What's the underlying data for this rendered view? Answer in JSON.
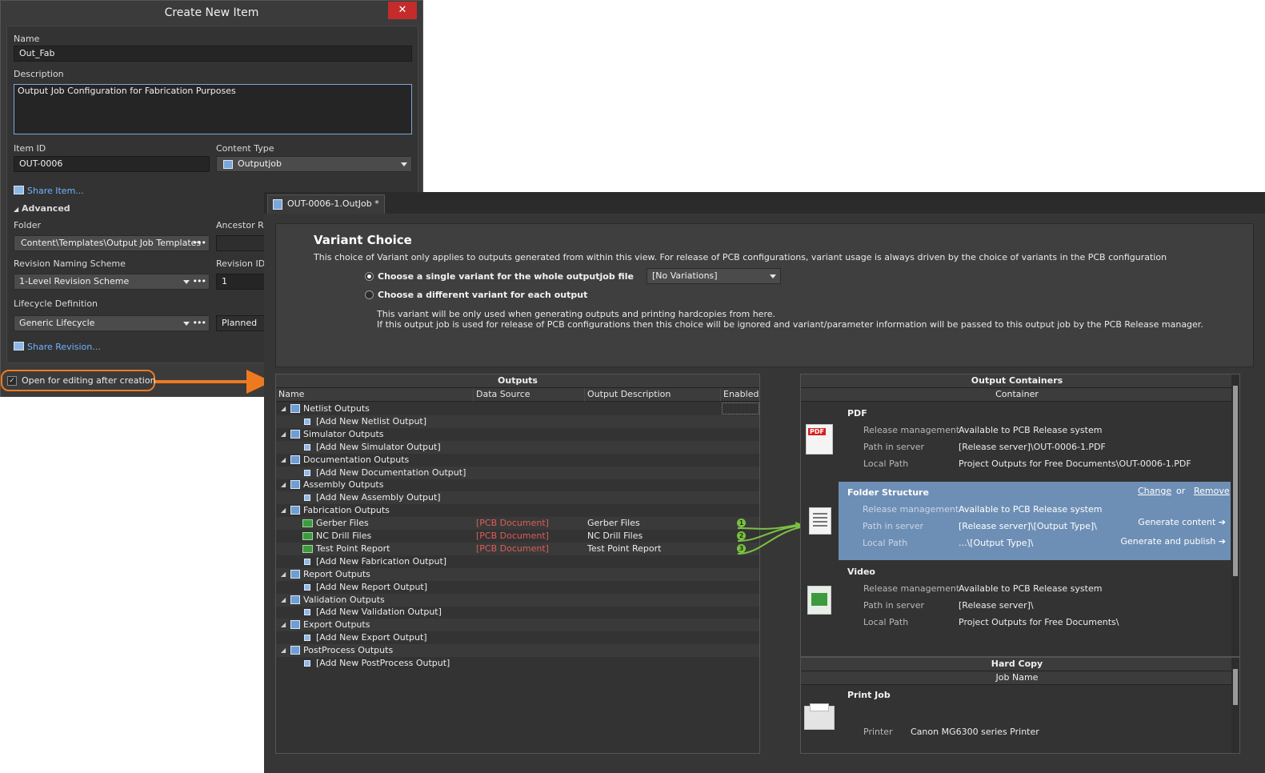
{
  "dialog": {
    "title": "Create New Item",
    "close": "✕",
    "name_label": "Name",
    "name_value": "Out_Fab",
    "description_label": "Description",
    "description_value": "Output Job Configuration for Fabrication Purposes",
    "item_id_label": "Item ID",
    "item_id_value": "OUT-0006",
    "content_type_label": "Content Type",
    "content_type_value": "Outputjob",
    "share_item": "Share Item...",
    "advanced": "Advanced",
    "folder_label": "Folder",
    "folder_value": "Content\\Templates\\Output Job Templates",
    "ancestor_label": "Ancestor Re",
    "revision_scheme_label": "Revision Naming Scheme",
    "revision_scheme_value": "1-Level Revision Scheme",
    "revision_id_label": "Revision ID",
    "revision_id_value": "1",
    "lifecycle_label": "Lifecycle Definition",
    "lifecycle_value": "Generic Lifecycle",
    "lifecycle_state": "Planned",
    "share_revision": "Share Revision...",
    "open_for_editing": "Open for editing after creation",
    "dots": "•••"
  },
  "editor": {
    "tab": "OUT-0006-1.OutJob *",
    "variant": {
      "title": "Variant Choice",
      "description": "This choice of Variant only applies to outputs generated from within this view. For release of PCB configurations, variant usage is always driven by the choice of variants in the PCB configuration",
      "option1": "Choose a single variant for the whole outputjob file",
      "option2": "Choose a different variant for each output",
      "variant_select": "[No Variations]",
      "note1": "This variant will be only used when generating outputs and printing hardcopies from here.",
      "note2": "If this output job is used for release of PCB configurations then this choice will be ignored and variant/parameter information will be passed to this output job by the PCB Release manager."
    },
    "outputs": {
      "title": "Outputs",
      "columns": [
        "Name",
        "Data Source",
        "Output Description",
        "Enabled"
      ],
      "rows": [
        {
          "kind": "group",
          "name": "Netlist Outputs"
        },
        {
          "kind": "add",
          "name": "[Add New Netlist Output]"
        },
        {
          "kind": "group",
          "name": "Simulator Outputs"
        },
        {
          "kind": "add",
          "name": "[Add New Simulator Output]"
        },
        {
          "kind": "group",
          "name": "Documentation Outputs"
        },
        {
          "kind": "add",
          "name": "[Add New Documentation Output]"
        },
        {
          "kind": "group",
          "name": "Assembly Outputs"
        },
        {
          "kind": "add",
          "name": "[Add New Assembly Output]"
        },
        {
          "kind": "group",
          "name": "Fabrication Outputs"
        },
        {
          "kind": "item",
          "name": "Gerber Files",
          "source": "[PCB Document]",
          "desc": "Gerber Files",
          "badge": "1"
        },
        {
          "kind": "item",
          "name": "NC Drill Files",
          "source": "[PCB Document]",
          "desc": "NC Drill Files",
          "badge": "2"
        },
        {
          "kind": "item",
          "name": "Test Point Report",
          "source": "[PCB Document]",
          "desc": "Test Point Report",
          "badge": "3"
        },
        {
          "kind": "add",
          "name": "[Add New Fabrication Output]"
        },
        {
          "kind": "group",
          "name": "Report Outputs"
        },
        {
          "kind": "add",
          "name": "[Add New Report Output]"
        },
        {
          "kind": "group",
          "name": "Validation Outputs"
        },
        {
          "kind": "add",
          "name": "[Add New Validation Output]"
        },
        {
          "kind": "group",
          "name": "Export Outputs"
        },
        {
          "kind": "add",
          "name": "[Add New Export Output]"
        },
        {
          "kind": "group",
          "name": "PostProcess Outputs"
        },
        {
          "kind": "add",
          "name": "[Add New PostProcess Output]"
        }
      ]
    },
    "containers": {
      "title": "Output Containers",
      "subtitle": "Container",
      "release_label": "Release management",
      "path_label": "Path in server",
      "local_label": "Local Path",
      "pdf": {
        "name": "PDF",
        "release": "Available to PCB Release system",
        "path": "[Release server]\\OUT-0006-1.PDF",
        "local": "Project Outputs for Free Documents\\OUT-0006-1.PDF"
      },
      "folder": {
        "name": "Folder Structure",
        "change": "Change",
        "or": "or",
        "remove": "Remove",
        "release": "Available to PCB Release system",
        "path": "[Release server]\\[Output Type]\\",
        "local": "...\\[Output Type]\\",
        "generate_content": "Generate content ➔",
        "generate_publish": "Generate and publish ➔"
      },
      "video": {
        "name": "Video",
        "release": "Available to PCB Release system",
        "path": "[Release server]\\",
        "local": "Project Outputs for Free Documents\\"
      }
    },
    "hardcopy": {
      "title": "Hard Copy",
      "subtitle": "Job Name",
      "job": "Print Job",
      "printer_label": "Printer",
      "printer_value": "Canon MG6300 series Printer"
    }
  },
  "colors": {
    "callout": "#ee7a20",
    "connector": "#7bc043",
    "selection": "#6e8fb5",
    "close": "#c42b2b"
  }
}
